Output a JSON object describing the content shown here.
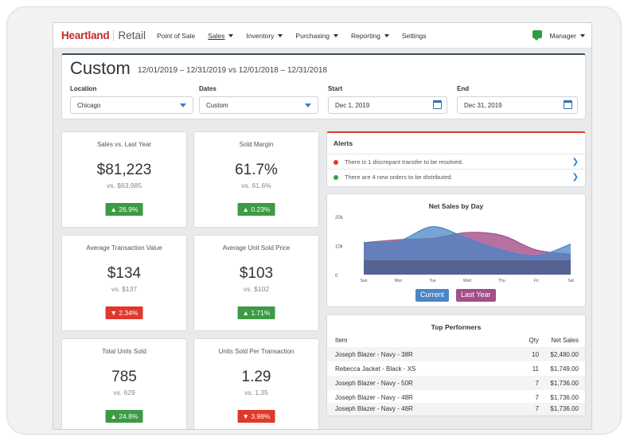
{
  "nav": {
    "brand_primary": "Heartland",
    "brand_secondary": "Retail",
    "items": [
      {
        "label": "Point of Sale"
      },
      {
        "label": "Sales"
      },
      {
        "label": "Inventory"
      },
      {
        "label": "Purchasing"
      },
      {
        "label": "Reporting"
      },
      {
        "label": "Settings"
      }
    ],
    "user": "Manager"
  },
  "header": {
    "title": "Custom",
    "date_range": "12/01/2019 – 12/31/2019 vs 12/01/2018 – 12/31/2018",
    "filters": {
      "location_label": "Location",
      "location_value": "Chicago",
      "dates_label": "Dates",
      "dates_value": "Custom",
      "start_label": "Start",
      "start_value": "Dec 1, 2019",
      "end_label": "End",
      "end_value": "Dec 31, 2019"
    }
  },
  "metrics": [
    {
      "title": "Sales vs. Last Year",
      "value": "$81,223",
      "vs": "vs. $63,985",
      "change": "▲ 26.9%",
      "direction": "up"
    },
    {
      "title": "Sold Margin",
      "value": "61.7%",
      "vs": "vs. 61.6%",
      "change": "▲ 0.23%",
      "direction": "up"
    },
    {
      "title": "Average Transaction Value",
      "value": "$134",
      "vs": "vs. $137",
      "change": "▼ 2.34%",
      "direction": "down"
    },
    {
      "title": "Average Unit Sold Price",
      "value": "$103",
      "vs": "vs. $102",
      "change": "▲ 1.71%",
      "direction": "up"
    },
    {
      "title": "Total Units Sold",
      "value": "785",
      "vs": "vs. 629",
      "change": "▲ 24.8%",
      "direction": "up"
    },
    {
      "title": "Units Sold Per Transaction",
      "value": "1.29",
      "vs": "vs. 1.35",
      "change": "▼ 3.98%",
      "direction": "down"
    }
  ],
  "alerts": {
    "title": "Alerts",
    "items": [
      {
        "text": "There is 1 discrepant transfer to be resolved.",
        "color": "#e0382b"
      },
      {
        "text": "There are 4 new orders to be distributed.",
        "color": "#3d9a45"
      }
    ]
  },
  "net_sales": {
    "title": "Net Sales by Day",
    "y_ticks": [
      "20k",
      "10k",
      "0"
    ],
    "x_ticks": [
      "Sun",
      "Mon",
      "Tue",
      "Wed",
      "Thu",
      "Fri",
      "Sat"
    ],
    "legend_current": "Current",
    "legend_last_year": "Last Year",
    "current_color": "#4a86c5",
    "last_year_color": "#a24f8a"
  },
  "top_performers": {
    "title": "Top Performers",
    "headers": {
      "item": "Item",
      "qty": "Qty",
      "sales": "Net Sales"
    },
    "rows": [
      {
        "item": "Joseph Blazer - Navy - 38R",
        "qty": "10",
        "sales": "$2,480.00"
      },
      {
        "item": "Rebecca Jacket - Black - XS",
        "qty": "11",
        "sales": "$1,749.00"
      },
      {
        "item": "Joseph Blazer - Navy - 50R",
        "qty": "7",
        "sales": "$1,736.00"
      },
      {
        "item": "Joseph Blazer - Navy - 48R",
        "qty": "7",
        "sales": "$1,736.00"
      },
      {
        "item": "Joseph Blazer - Navy - 46R",
        "qty": "7",
        "sales": "$1,736.00"
      }
    ]
  },
  "chart_data": {
    "type": "area",
    "title": "Net Sales by Day",
    "categories": [
      "Sun",
      "Mon",
      "Tue",
      "Wed",
      "Thu",
      "Fri",
      "Sat"
    ],
    "ylim": [
      0,
      20000
    ],
    "series": [
      {
        "name": "Current",
        "values": [
          11000,
          11500,
          16500,
          12500,
          8500,
          6500,
          10500
        ]
      },
      {
        "name": "Last Year",
        "values": [
          11000,
          12000,
          12500,
          14500,
          13500,
          8500,
          7000
        ]
      }
    ]
  }
}
